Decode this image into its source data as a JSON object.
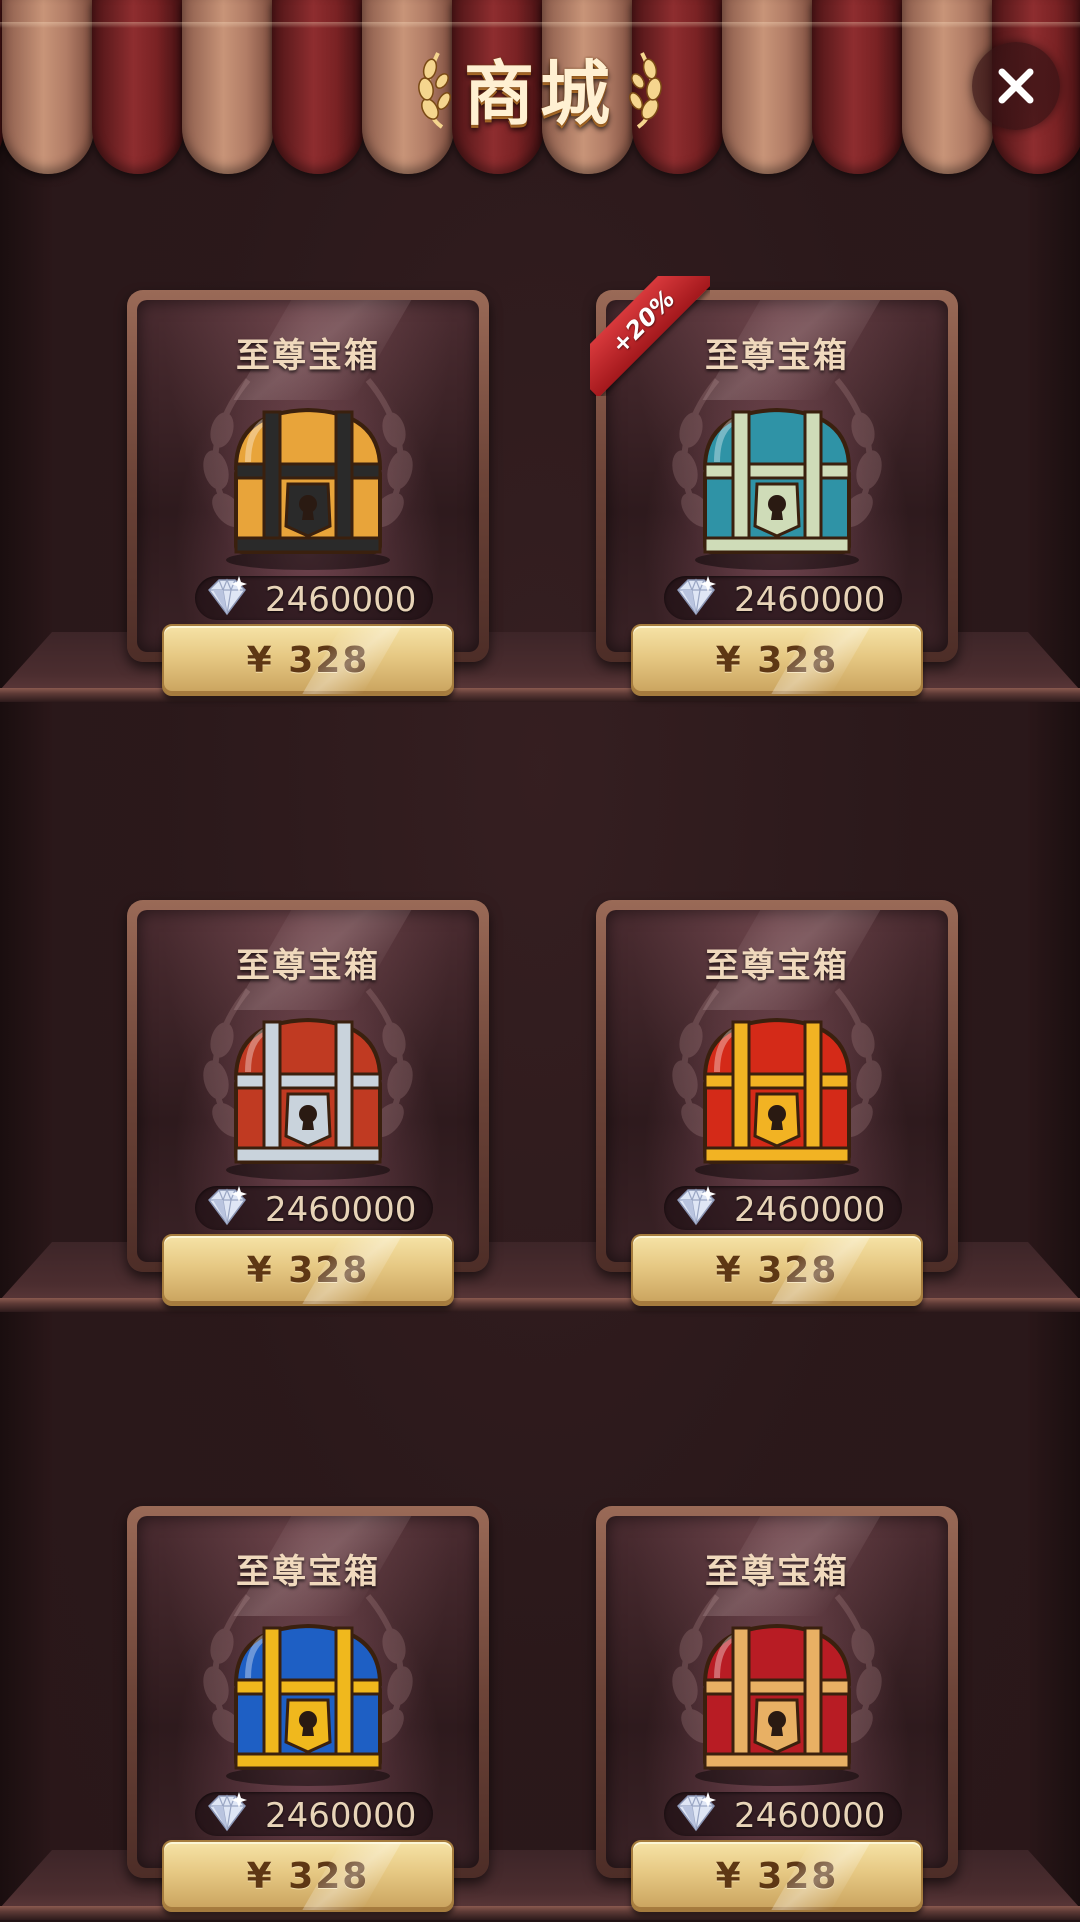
{
  "header": {
    "title": "商城",
    "close_icon": "close-icon"
  },
  "currency_icon": "diamond-icon",
  "promo_badge": "+20%",
  "products": [
    {
      "name": "至尊宝箱",
      "gems": "2460000",
      "price": "¥ 328",
      "chest": "gold-black-chest",
      "colors": [
        "#e8a43a",
        "#2a2a2a"
      ]
    },
    {
      "name": "至尊宝箱",
      "gems": "2460000",
      "price": "¥ 328",
      "chest": "teal-chest",
      "colors": [
        "#2f93a6",
        "#cfdcb8"
      ],
      "badge": "+20%"
    },
    {
      "name": "至尊宝箱",
      "gems": "2460000",
      "price": "¥ 328",
      "chest": "silver-red-chest",
      "colors": [
        "#c03a22",
        "#c9d3dc"
      ]
    },
    {
      "name": "至尊宝箱",
      "gems": "2460000",
      "price": "¥ 328",
      "chest": "red-gold-chest",
      "colors": [
        "#d42a18",
        "#f2b323"
      ]
    },
    {
      "name": "至尊宝箱",
      "gems": "2460000",
      "price": "¥ 328",
      "chest": "blue-gold-chest",
      "colors": [
        "#1e5fc4",
        "#f0b81d"
      ]
    },
    {
      "name": "至尊宝箱",
      "gems": "2460000",
      "price": "¥ 328",
      "chest": "red-jeweled-chest",
      "colors": [
        "#b81c24",
        "#e8b064"
      ]
    }
  ]
}
